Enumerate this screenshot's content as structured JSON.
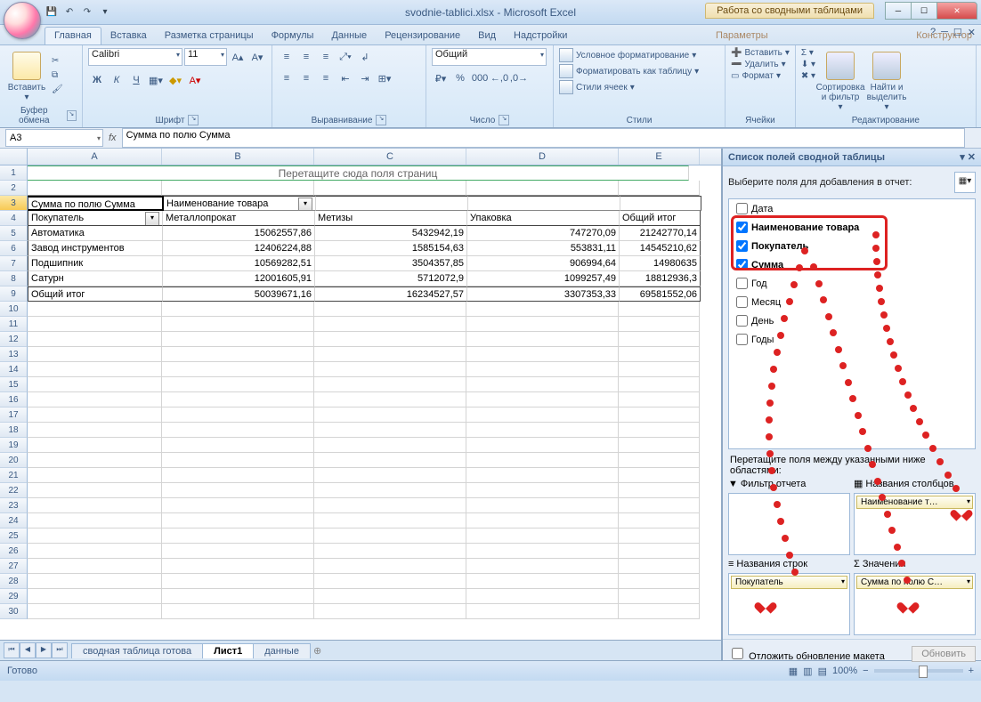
{
  "title": "svodnie-tablici.xlsx - Microsoft Excel",
  "context_tab": "Работа со сводными таблицами",
  "tabs": [
    "Главная",
    "Вставка",
    "Разметка страницы",
    "Формулы",
    "Данные",
    "Рецензирование",
    "Вид",
    "Надстройки"
  ],
  "ctx_tabs": [
    "Параметры",
    "Конструктор"
  ],
  "ribbon": {
    "clipboard": {
      "paste": "Вставить",
      "label": "Буфер обмена"
    },
    "font": {
      "name": "Calibri",
      "size": "11",
      "label": "Шрифт"
    },
    "align": {
      "label": "Выравнивание"
    },
    "number": {
      "fmt": "Общий",
      "label": "Число"
    },
    "styles": {
      "cond": "Условное форматирование",
      "table": "Форматировать как таблицу",
      "cell": "Стили ячеек",
      "label": "Стили"
    },
    "cells": {
      "insert": "Вставить",
      "delete": "Удалить",
      "format": "Формат",
      "label": "Ячейки"
    },
    "editing": {
      "sort": "Сортировка и фильтр",
      "find": "Найти и выделить",
      "label": "Редактирование"
    }
  },
  "namebox": "A3",
  "formula": "Сумма по полю Сумма",
  "pivot": {
    "page_prompt": "Перетащите сюда поля страниц",
    "data_field": "Сумма по полю Сумма",
    "col_field": "Наименование товара",
    "row_field": "Покупатель",
    "cols": [
      "Металлопрокат",
      "Метизы",
      "Упаковка",
      "Общий итог"
    ],
    "rows": [
      {
        "label": "Автоматика",
        "v": [
          "15062557,86",
          "5432942,19",
          "747270,09",
          "21242770,14"
        ]
      },
      {
        "label": "Завод инструментов",
        "v": [
          "12406224,88",
          "1585154,63",
          "553831,11",
          "14545210,62"
        ]
      },
      {
        "label": "Подшипник",
        "v": [
          "10569282,51",
          "3504357,85",
          "906994,64",
          "14980635"
        ]
      },
      {
        "label": "Сатурн",
        "v": [
          "12001605,91",
          "5712072,9",
          "1099257,49",
          "18812936,3"
        ]
      },
      {
        "label": "Общий итог",
        "v": [
          "50039671,16",
          "16234527,57",
          "3307353,33",
          "69581552,06"
        ]
      }
    ]
  },
  "sheets": [
    "сводная таблица готова",
    "Лист1",
    "данные"
  ],
  "active_sheet": 1,
  "pane": {
    "title": "Список полей сводной таблицы",
    "choose": "Выберите поля для добавления в отчет:",
    "fields": [
      {
        "label": "Дата",
        "checked": false
      },
      {
        "label": "Наименование товара",
        "checked": true
      },
      {
        "label": "Покупатель",
        "checked": true
      },
      {
        "label": "Сумма",
        "checked": true
      },
      {
        "label": "Год",
        "checked": false
      },
      {
        "label": "Месяц",
        "checked": false
      },
      {
        "label": "День",
        "checked": false
      },
      {
        "label": "Годы",
        "checked": false
      }
    ],
    "drag_label": "Перетащите поля между указанными ниже областями:",
    "filter": "Фильтр отчета",
    "columns": "Названия столбцов",
    "rows": "Названия строк",
    "values": "Значения",
    "col_item": "Наименование т…",
    "row_item": "Покупатель",
    "val_item": "Сумма по полю С…",
    "defer": "Отложить обновление макета",
    "update": "Обновить"
  },
  "status": "Готово",
  "zoom": "100%"
}
